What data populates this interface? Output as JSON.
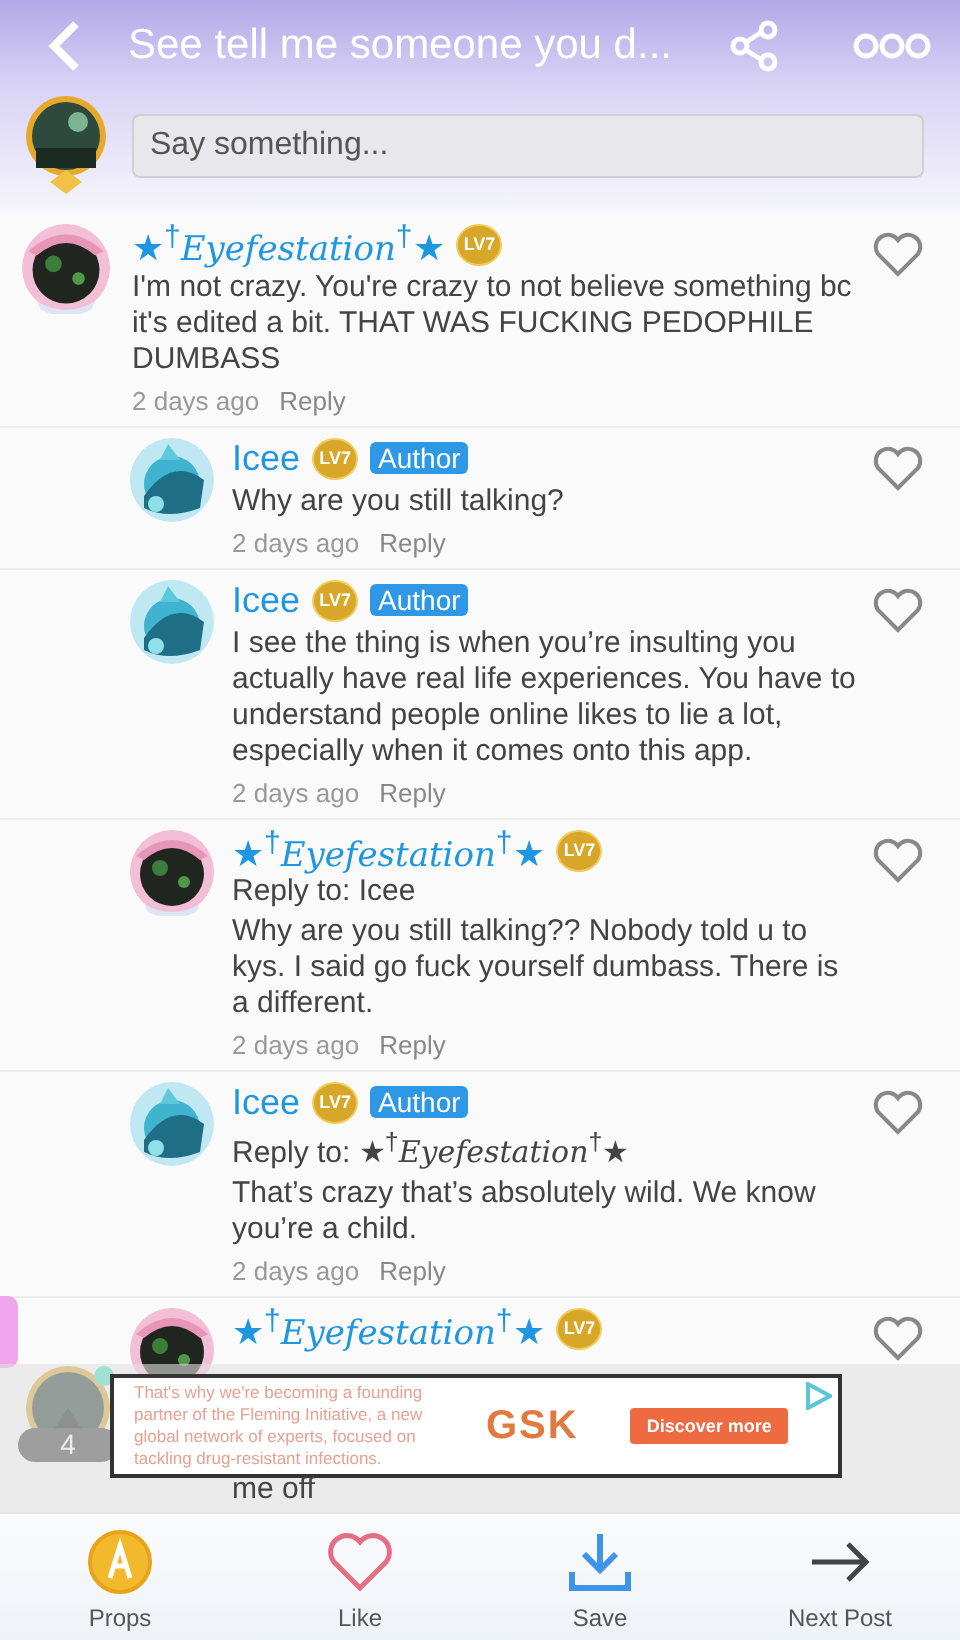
{
  "header": {
    "title": "See tell me someone you d..."
  },
  "composer": {
    "placeholder": "Say something..."
  },
  "comments": [
    {
      "name": "★$^{†}$*Eyefestation*$^{†}$★",
      "level": "LV7",
      "body": "I'm not crazy. You're crazy to not believe something bc it's edited a bit. THAT WAS FUCKING PEDOPHILE DUMBASS",
      "time": "2 days ago",
      "reply": "Reply",
      "liked": false,
      "covered": false,
      "children": [
        {
          "name": "Icee",
          "level": "LV7",
          "tag": "Author",
          "body": "Why are you still talking?",
          "time": "2 days ago",
          "reply": "Reply",
          "liked": false,
          "covered": false
        },
        {
          "name": "Icee",
          "level": "LV7",
          "tag": "Author",
          "body": "I see the thing is when you’re insulting you actually have real life experiences. You have to understand people online likes to lie a lot, especially when it comes onto this app.",
          "time": "2 days ago",
          "reply": "Reply",
          "liked": false,
          "covered": false
        },
        {
          "name": "★$^{†}$*Eyefestation*$^{†}$★",
          "level": "LV7",
          "reply_to": "Reply to: Icee",
          "body": "Why are you still talking?? Nobody told u to kys. I said go fuck yourself dumbass. There is a different.",
          "time": "2 days ago",
          "reply": "Reply",
          "liked": false,
          "covered": false
        },
        {
          "name": "Icee",
          "level": "LV7",
          "tag": "Author",
          "reply_to": "Reply to: ★$^{†}$*Eyefestation*$^{†}$★",
          "body": "That’s crazy that’s absolutely wild. We know you’re a child.",
          "time": "2 days ago",
          "reply": "Reply",
          "liked": false,
          "covered": false
        },
        {
          "name": "★$^{†}$*Eyefestation*$^{†}$★",
          "level": "LV7",
          "body": "me off",
          "liked": false,
          "covered": true
        }
      ]
    }
  ],
  "online_bubble": {
    "count": "4"
  },
  "ad": {
    "text": "That's why we're becoming a founding partner of the Fleming Initiative, a new global network of experts, focused on tackling drug-resistant infections.",
    "brand": "GSK",
    "button": "Discover more"
  },
  "bottom_bar": [
    {
      "kind": "props",
      "label": "Props"
    },
    {
      "kind": "like",
      "label": "Like"
    },
    {
      "kind": "save",
      "label": "Save"
    },
    {
      "kind": "next",
      "label": "Next Post"
    }
  ]
}
